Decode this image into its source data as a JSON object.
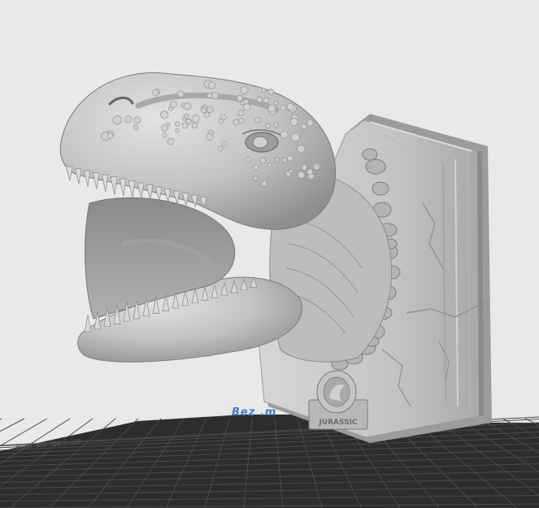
{
  "viewport": {
    "background": "#e9e9e9",
    "model_color": "#c4c4c4",
    "build_plate_color": "#2d2d2d",
    "grid_line_color": "#4a4a4a"
  },
  "model": {
    "icon": "dinosaur-head-wall-mount-model",
    "badge_text": "JURASSIC"
  },
  "build_plate": {
    "brand_label": "Bez .m",
    "edge_label": "PRINT BED 220 x 220"
  }
}
